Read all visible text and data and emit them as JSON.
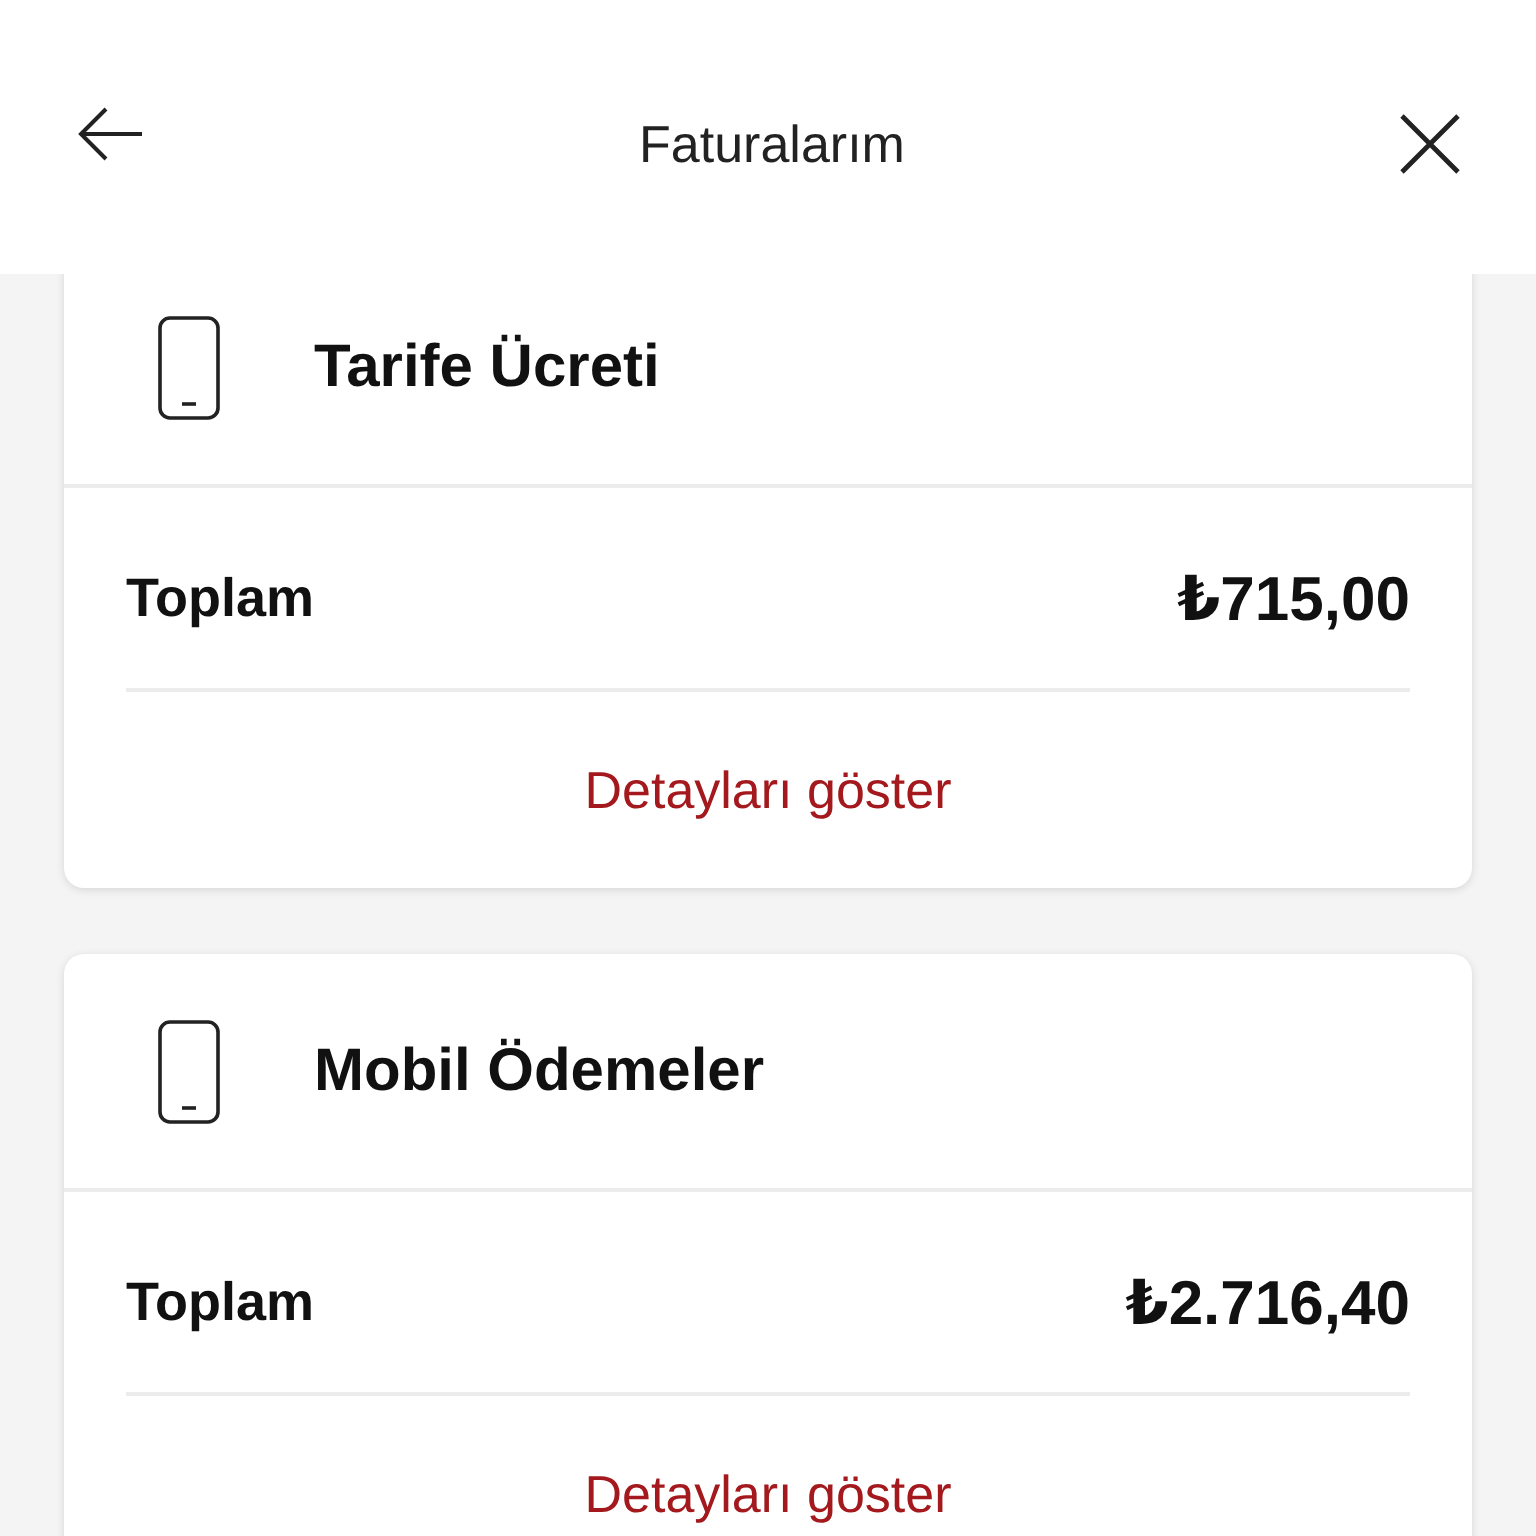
{
  "header": {
    "title": "Faturalarım"
  },
  "cards": [
    {
      "title": "Tarife Ücreti",
      "total_label": "Toplam",
      "total_amount": "₺715,00",
      "link": "Detayları göster"
    },
    {
      "title": "Mobil Ödemeler",
      "total_label": "Toplam",
      "total_amount": "₺2.716,40",
      "link": "Detayları göster"
    }
  ]
}
